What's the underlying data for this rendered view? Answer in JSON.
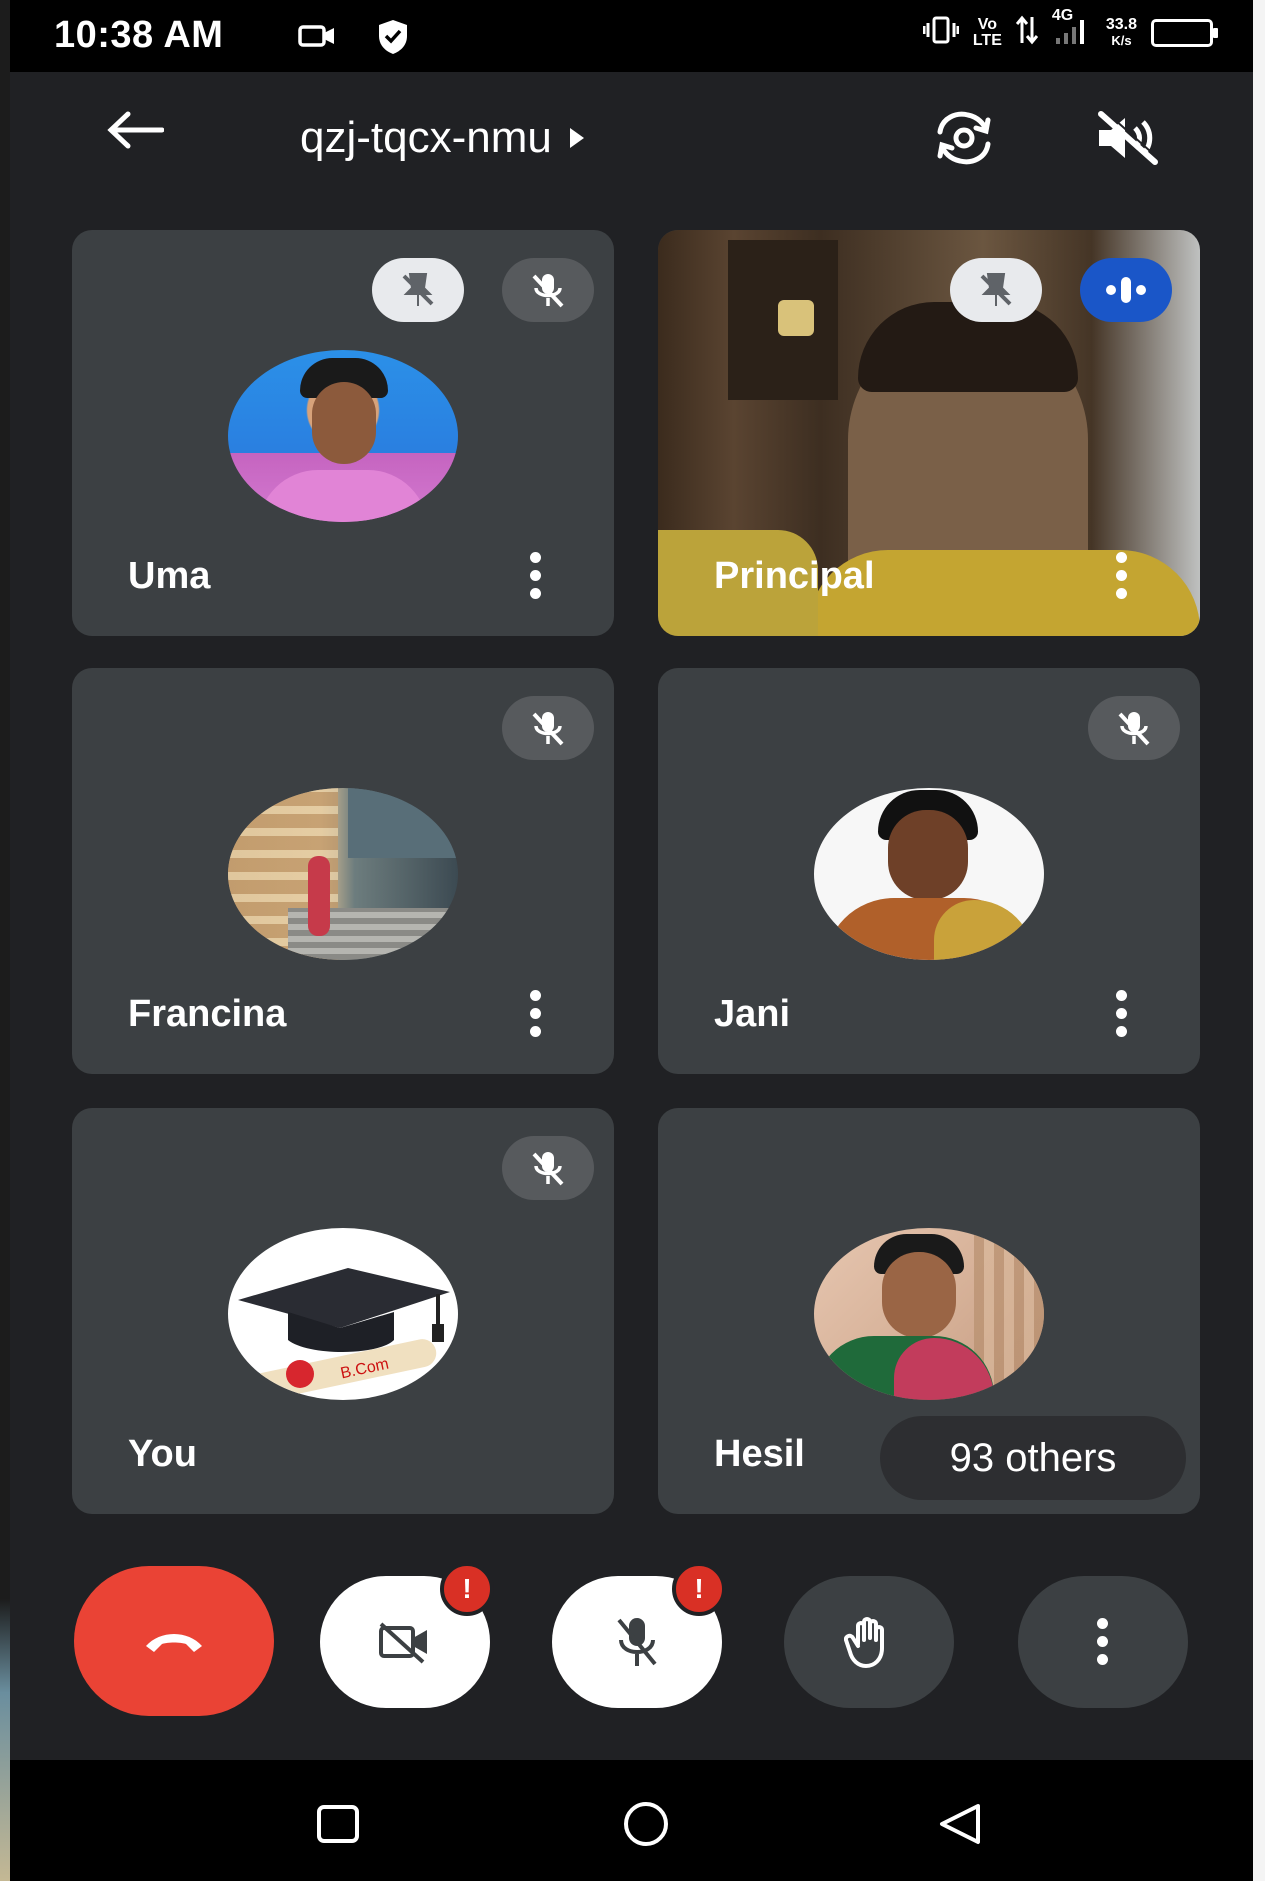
{
  "status_bar": {
    "time": "10:38 AM",
    "volte": "Vo\nLTE",
    "network": "4G",
    "speed": "33.8",
    "speed_unit": "K/s",
    "icons": [
      "video-camera-icon",
      "shield-icon",
      "vibrate-icon",
      "data-arrows-icon",
      "signal-icon",
      "battery-icon"
    ]
  },
  "header": {
    "meeting_code": "qzj-tqcx-nmu",
    "icons": [
      "back-arrow-icon",
      "switch-camera-icon",
      "speaker-off-icon"
    ]
  },
  "participants": [
    {
      "name": "Uma",
      "pinned_badge": true,
      "muted": true,
      "speaking": false,
      "video": false
    },
    {
      "name": "Principal",
      "pinned_badge": true,
      "muted": false,
      "speaking": true,
      "video": true
    },
    {
      "name": "Francina",
      "pinned_badge": false,
      "muted": true,
      "speaking": false,
      "video": false
    },
    {
      "name": "Jani",
      "pinned_badge": false,
      "muted": true,
      "speaking": false,
      "video": false
    },
    {
      "name": "You",
      "pinned_badge": false,
      "muted": true,
      "speaking": false,
      "video": false
    },
    {
      "name": "Hesil",
      "pinned_badge": false,
      "muted": false,
      "speaking": false,
      "video": false
    }
  ],
  "others_label": "93 others",
  "controls": {
    "alert_mark": "!",
    "icons": [
      "end-call-icon",
      "camera-off-icon",
      "mic-off-icon",
      "raise-hand-icon",
      "more-options-icon"
    ]
  },
  "colors": {
    "background": "#202124",
    "tile": "#3c4043",
    "end_call": "#ea4335",
    "speaking": "#1a56c8",
    "alert": "#d93025"
  }
}
